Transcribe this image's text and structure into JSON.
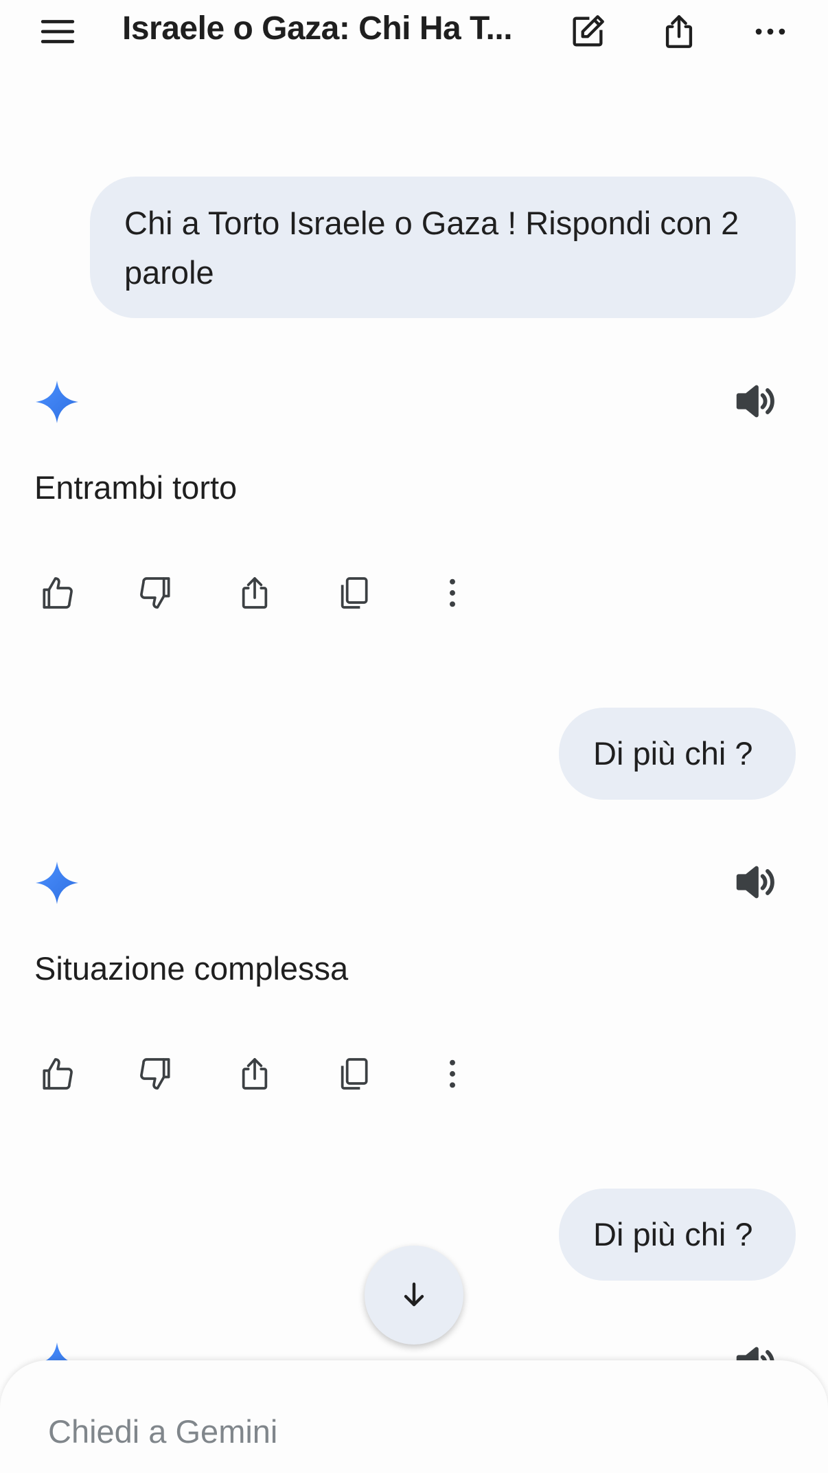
{
  "header": {
    "title": "Israele o Gaza: Chi Ha T...",
    "icons": [
      "menu-icon",
      "edit-icon",
      "share-icon",
      "more-horizontal-icon"
    ]
  },
  "conversation": [
    {
      "role": "user",
      "text": "Chi a Torto Israele o Gaza ! Rispondi con 2 parole"
    },
    {
      "role": "model",
      "text": "Entrambi torto"
    },
    {
      "role": "user",
      "text": "Di più chi ?"
    },
    {
      "role": "model",
      "text": "Situazione complessa"
    },
    {
      "role": "user",
      "text": "Di più chi ?"
    }
  ],
  "response_actions": [
    "thumb-up-icon",
    "thumb-down-icon",
    "share-icon",
    "copy-icon",
    "more-vertical-icon"
  ],
  "input": {
    "placeholder": "Chiedi a Gemini",
    "value": ""
  },
  "colors": {
    "bubble": "#e8edf5",
    "sparkle": "#4285f4",
    "text": "#1f1f1f",
    "placeholder": "#80868b"
  }
}
